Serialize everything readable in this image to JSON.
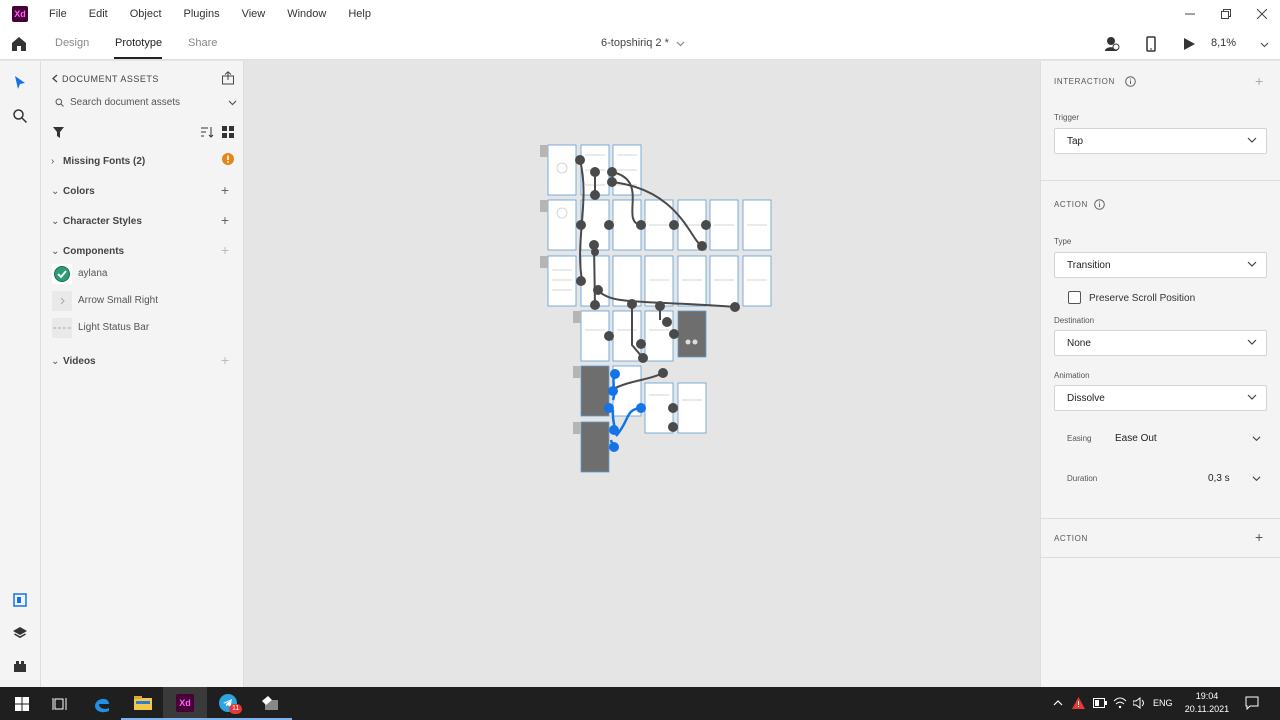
{
  "app": {
    "logo_text": "Xd",
    "menu": [
      "File",
      "Edit",
      "Object",
      "Plugins",
      "View",
      "Window",
      "Help"
    ]
  },
  "tabs": {
    "design": "Design",
    "prototype": "Prototype",
    "share": "Share",
    "active": "Prototype"
  },
  "document": {
    "title": "6-topshiriq 2 *"
  },
  "toolbar": {
    "zoom": "8,1%"
  },
  "assets": {
    "title": "DOCUMENT ASSETS",
    "search_placeholder": "Search document assets",
    "missing_fonts": "Missing Fonts (2)",
    "sections": {
      "colors": "Colors",
      "character_styles": "Character Styles",
      "components": "Components",
      "videos": "Videos"
    },
    "components": [
      "aylana",
      "Arrow Small Right",
      "Light Status Bar"
    ]
  },
  "properties": {
    "interaction_header": "INTERACTION",
    "trigger_label": "Trigger",
    "trigger_value": "Tap",
    "action_header": "ACTION",
    "type_label": "Type",
    "type_value": "Transition",
    "preserve_scroll": "Preserve Scroll Position",
    "destination_label": "Destination",
    "destination_value": "None",
    "animation_label": "Animation",
    "animation_value": "Dissolve",
    "easing_label": "Easing",
    "easing_value": "Ease Out",
    "duration_label": "Duration",
    "duration_value": "0,3 s",
    "action2_header": "ACTION"
  },
  "taskbar": {
    "time": "19:04",
    "date": "20.11.2021",
    "lang": "ENG",
    "telegram_badge": "11"
  },
  "colors": {
    "accent_blue": "#1473e6",
    "warning_orange": "#e68619",
    "success_green": "#2d9d78"
  }
}
